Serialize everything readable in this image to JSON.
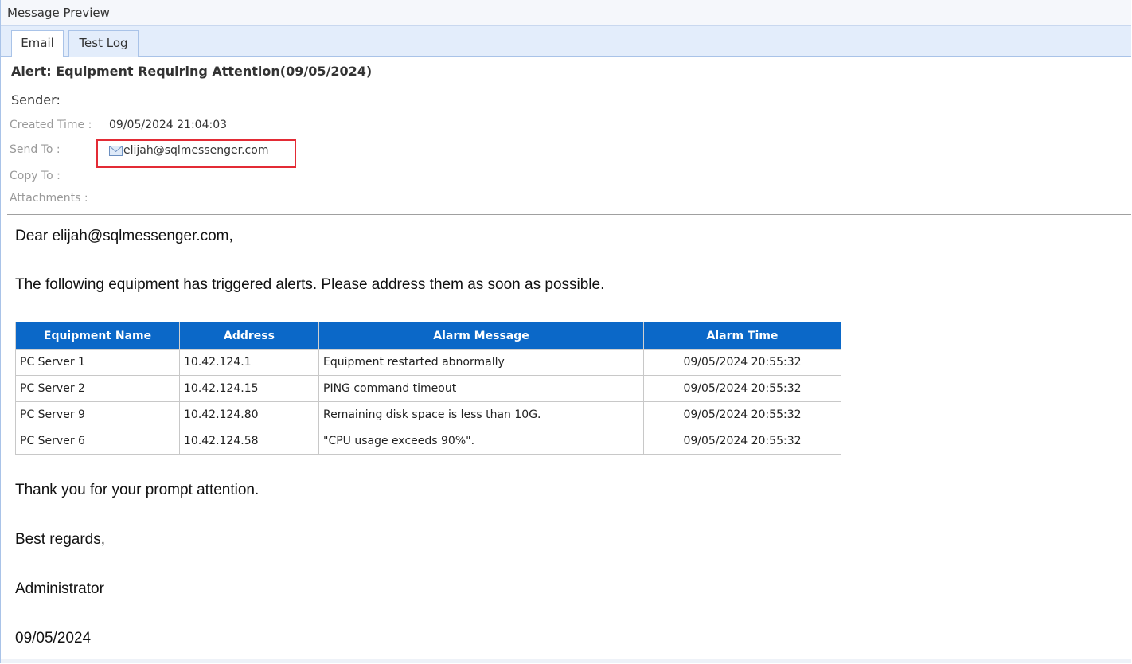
{
  "window": {
    "title": "Message Preview"
  },
  "tabs": [
    {
      "label": "Email",
      "active": true
    },
    {
      "label": "Test Log",
      "active": false
    }
  ],
  "header": {
    "subject": "Alert: Equipment Requiring Attention(09/05/2024)",
    "sender_label": "Sender:",
    "created_time_label": "Created Time :",
    "created_time_value": "09/05/2024 21:04:03",
    "send_to_label": "Send To :",
    "send_to_value": "elijah@sqlmessenger.com",
    "send_to_icon": "envelope-icon",
    "copy_to_label": "Copy To :",
    "attachments_label": "Attachments :"
  },
  "body": {
    "greeting": "Dear elijah@sqlmessenger.com,",
    "intro": "The following equipment has triggered alerts. Please address them as soon as possible.",
    "table": {
      "columns": [
        "Equipment Name",
        "Address",
        "Alarm Message",
        "Alarm Time"
      ],
      "rows": [
        [
          "PC Server 1",
          "10.42.124.1",
          "Equipment restarted abnormally",
          "09/05/2024 20:55:32"
        ],
        [
          "PC Server 2",
          "10.42.124.15",
          "PING command timeout",
          "09/05/2024 20:55:32"
        ],
        [
          "PC Server 9",
          "10.42.124.80",
          "Remaining disk space is less than 10G.",
          "09/05/2024 20:55:32"
        ],
        [
          "PC Server 6",
          "10.42.124.58",
          "\"CPU usage exceeds 90%\".",
          "09/05/2024 20:55:32"
        ]
      ]
    },
    "thanks": "Thank you for your prompt attention.",
    "closing": "Best regards,",
    "signature": "Administrator",
    "date": "09/05/2024"
  },
  "colors": {
    "table_header_bg": "#0b68c8",
    "highlight_border": "#e32b35",
    "tab_strip_bg": "#e3edfb"
  }
}
